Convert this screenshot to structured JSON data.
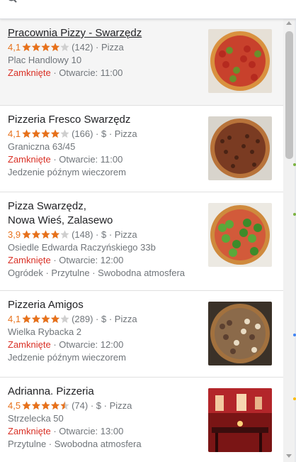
{
  "header": {
    "search_icon": "search-icon"
  },
  "colors": {
    "rating": "#e7711b",
    "star_filled": "#e7711b",
    "star_empty": "#cfcfcf",
    "closed": "#d93025",
    "secondary_text": "#70757a",
    "selected_bg": "#f5f5f5"
  },
  "results": [
    {
      "name_lines": [
        "Pracownia Pizzy - Swarzędz"
      ],
      "rating": "4,1",
      "rating_value": 4.1,
      "reviews": "(142)",
      "price": "",
      "category": "Pizza",
      "address": "Plac Handlowy 10",
      "status": "Zamknięte",
      "opens": "Otwarcie: 11:00",
      "extra": "",
      "selected": true,
      "image_icon": "pizza-photo"
    },
    {
      "name_lines": [
        "Pizzeria Fresco Swarzędz"
      ],
      "rating": "4,1",
      "rating_value": 4.1,
      "reviews": "(166)",
      "price": "$",
      "category": "Pizza",
      "address": "Graniczna 63/45",
      "status": "Zamknięte",
      "opens": "Otwarcie: 11:00",
      "extra": "Jedzenie późnym wieczorem",
      "selected": false,
      "image_icon": "pizza-photo"
    },
    {
      "name_lines": [
        "Pizza Swarzędz,",
        "Nowa Wieś, Zalasewo"
      ],
      "rating": "3,9",
      "rating_value": 3.9,
      "reviews": "(148)",
      "price": "$",
      "category": "Pizza",
      "address": "Osiedle Edwarda Raczyńskiego 33b",
      "status": "Zamknięte",
      "opens": "Otwarcie: 12:00",
      "extra": "Ogródek · Przytulne · Swobodna atmosfera",
      "selected": false,
      "image_icon": "pizza-photo"
    },
    {
      "name_lines": [
        "Pizzeria Amigos"
      ],
      "rating": "4,1",
      "rating_value": 4.1,
      "reviews": "(289)",
      "price": "$",
      "category": "Pizza",
      "address": "Wielka Rybacka 2",
      "status": "Zamknięte",
      "opens": "Otwarcie: 12:00",
      "extra": "Jedzenie późnym wieczorem",
      "selected": false,
      "image_icon": "pizza-photo"
    },
    {
      "name_lines": [
        "Adrianna. Pizzeria"
      ],
      "rating": "4,5",
      "rating_value": 4.5,
      "reviews": "(74)",
      "price": "$",
      "category": "Pizza",
      "address": "Strzelecka 50",
      "status": "Zamknięte",
      "opens": "Otwarcie: 13:00",
      "extra": "Przytulne · Swobodna atmosfera",
      "selected": false,
      "image_icon": "restaurant-interior-photo"
    }
  ]
}
